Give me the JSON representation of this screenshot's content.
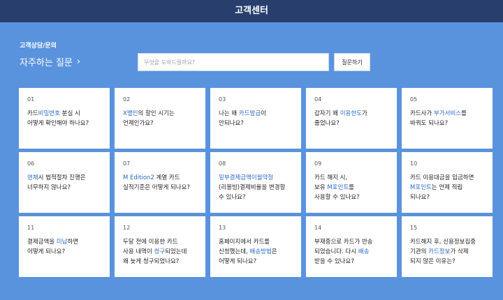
{
  "header": {
    "title": "고객센터"
  },
  "hero": {
    "subtitle": "고객상담/문의",
    "title": "자주하는 질문",
    "chevron_icon": "chevron-right-icon"
  },
  "search": {
    "placeholder": "무엇을 도와드릴까요?",
    "value": "",
    "button_label": "질문하기"
  },
  "faqs": [
    {
      "num": "01",
      "lines": [
        [
          {
            "t": "카드"
          },
          {
            "t": "비밀번호",
            "hl": true
          },
          {
            "t": " 분실 시"
          }
        ],
        [
          {
            "t": "어떻게 확인해야 하나요?"
          }
        ]
      ]
    },
    {
      "num": "02",
      "lines": [
        [
          {
            "t": "X밸인",
            "hl": true
          },
          {
            "t": "의 할인 시기는"
          }
        ],
        [
          {
            "t": "언제인가요?"
          }
        ]
      ]
    },
    {
      "num": "03",
      "lines": [
        [
          {
            "t": "나는 왜 "
          },
          {
            "t": "카드발급",
            "hl": true
          },
          {
            "t": "이"
          }
        ],
        [
          {
            "t": "안되나요?"
          }
        ]
      ]
    },
    {
      "num": "04",
      "lines": [
        [
          {
            "t": "갑자기 왜 "
          },
          {
            "t": "이용한도",
            "hl": true
          },
          {
            "t": "가"
          }
        ],
        [
          {
            "t": "줄었나요?"
          }
        ]
      ]
    },
    {
      "num": "05",
      "lines": [
        [
          {
            "t": "카드사가 "
          },
          {
            "t": "부가서비스",
            "hl": true
          },
          {
            "t": "를"
          }
        ],
        [
          {
            "t": "바꿔도 되나요?"
          }
        ]
      ]
    },
    {
      "num": "06",
      "lines": [
        [
          {
            "t": "연체",
            "hl": true
          },
          {
            "t": "시 법적절차 진행은"
          }
        ],
        [
          {
            "t": "너무하지 않나요?"
          }
        ]
      ]
    },
    {
      "num": "07",
      "lines": [
        [
          {
            "t": "M Edition2",
            "hl": true
          },
          {
            "t": " 계열 카드"
          }
        ],
        [
          {
            "t": "실적기준은 어떻게 되나요?"
          }
        ]
      ]
    },
    {
      "num": "08",
      "lines": [
        [
          {
            "t": "일부결제금액이월약정",
            "hl": true
          }
        ],
        [
          {
            "t": "(리볼빙)결제비율을 변경할"
          }
        ],
        [
          {
            "t": "수 있나요?"
          }
        ]
      ]
    },
    {
      "num": "09",
      "lines": [
        [
          {
            "t": "카드 해지 시,"
          }
        ],
        [
          {
            "t": "보유 "
          },
          {
            "t": "M포인트",
            "hl": true
          },
          {
            "t": "를"
          }
        ],
        [
          {
            "t": "사용할 수 있나요?"
          }
        ]
      ]
    },
    {
      "num": "10",
      "lines": [
        [
          {
            "t": "카드 이용대금을 입금하면"
          }
        ],
        [
          {
            "t": "M포인트",
            "hl": true
          },
          {
            "t": "는 언제 적립"
          }
        ],
        [
          {
            "t": "되나요?"
          }
        ]
      ]
    },
    {
      "num": "11",
      "lines": [
        [
          {
            "t": "결제금액을 "
          },
          {
            "t": "미납",
            "hl": true
          },
          {
            "t": "하면"
          }
        ],
        [
          {
            "t": "어떻게 되나요?"
          }
        ]
      ]
    },
    {
      "num": "12",
      "lines": [
        [
          {
            "t": "두달 전에 이용한 카드"
          }
        ],
        [
          {
            "t": "사용 내역이 "
          },
          {
            "t": "청구",
            "hl": true
          },
          {
            "t": "되었는데"
          }
        ],
        [
          {
            "t": "왜 늦게 청구되었나요?"
          }
        ]
      ]
    },
    {
      "num": "13",
      "lines": [
        [
          {
            "t": "홈페이지에서 카드를"
          }
        ],
        [
          {
            "t": "신청했는데, "
          },
          {
            "t": "배송방법",
            "hl": true
          },
          {
            "t": "은"
          }
        ],
        [
          {
            "t": "어떻게 되나요?"
          }
        ]
      ]
    },
    {
      "num": "14",
      "lines": [
        [
          {
            "t": "부재중으로 카드가 반송"
          }
        ],
        [
          {
            "t": "되었습니다. 다시 "
          },
          {
            "t": "배송",
            "hl": true
          }
        ],
        [
          {
            "t": "받을 수 있나요?"
          }
        ]
      ]
    },
    {
      "num": "15",
      "lines": [
        [
          {
            "t": "카드해지 후, 신용정보집중"
          }
        ],
        [
          {
            "t": "기관의 "
          },
          {
            "t": "카드정보",
            "hl": true
          },
          {
            "t": "가 삭제"
          }
        ],
        [
          {
            "t": "되지 않은 이유는?"
          }
        ]
      ]
    }
  ]
}
